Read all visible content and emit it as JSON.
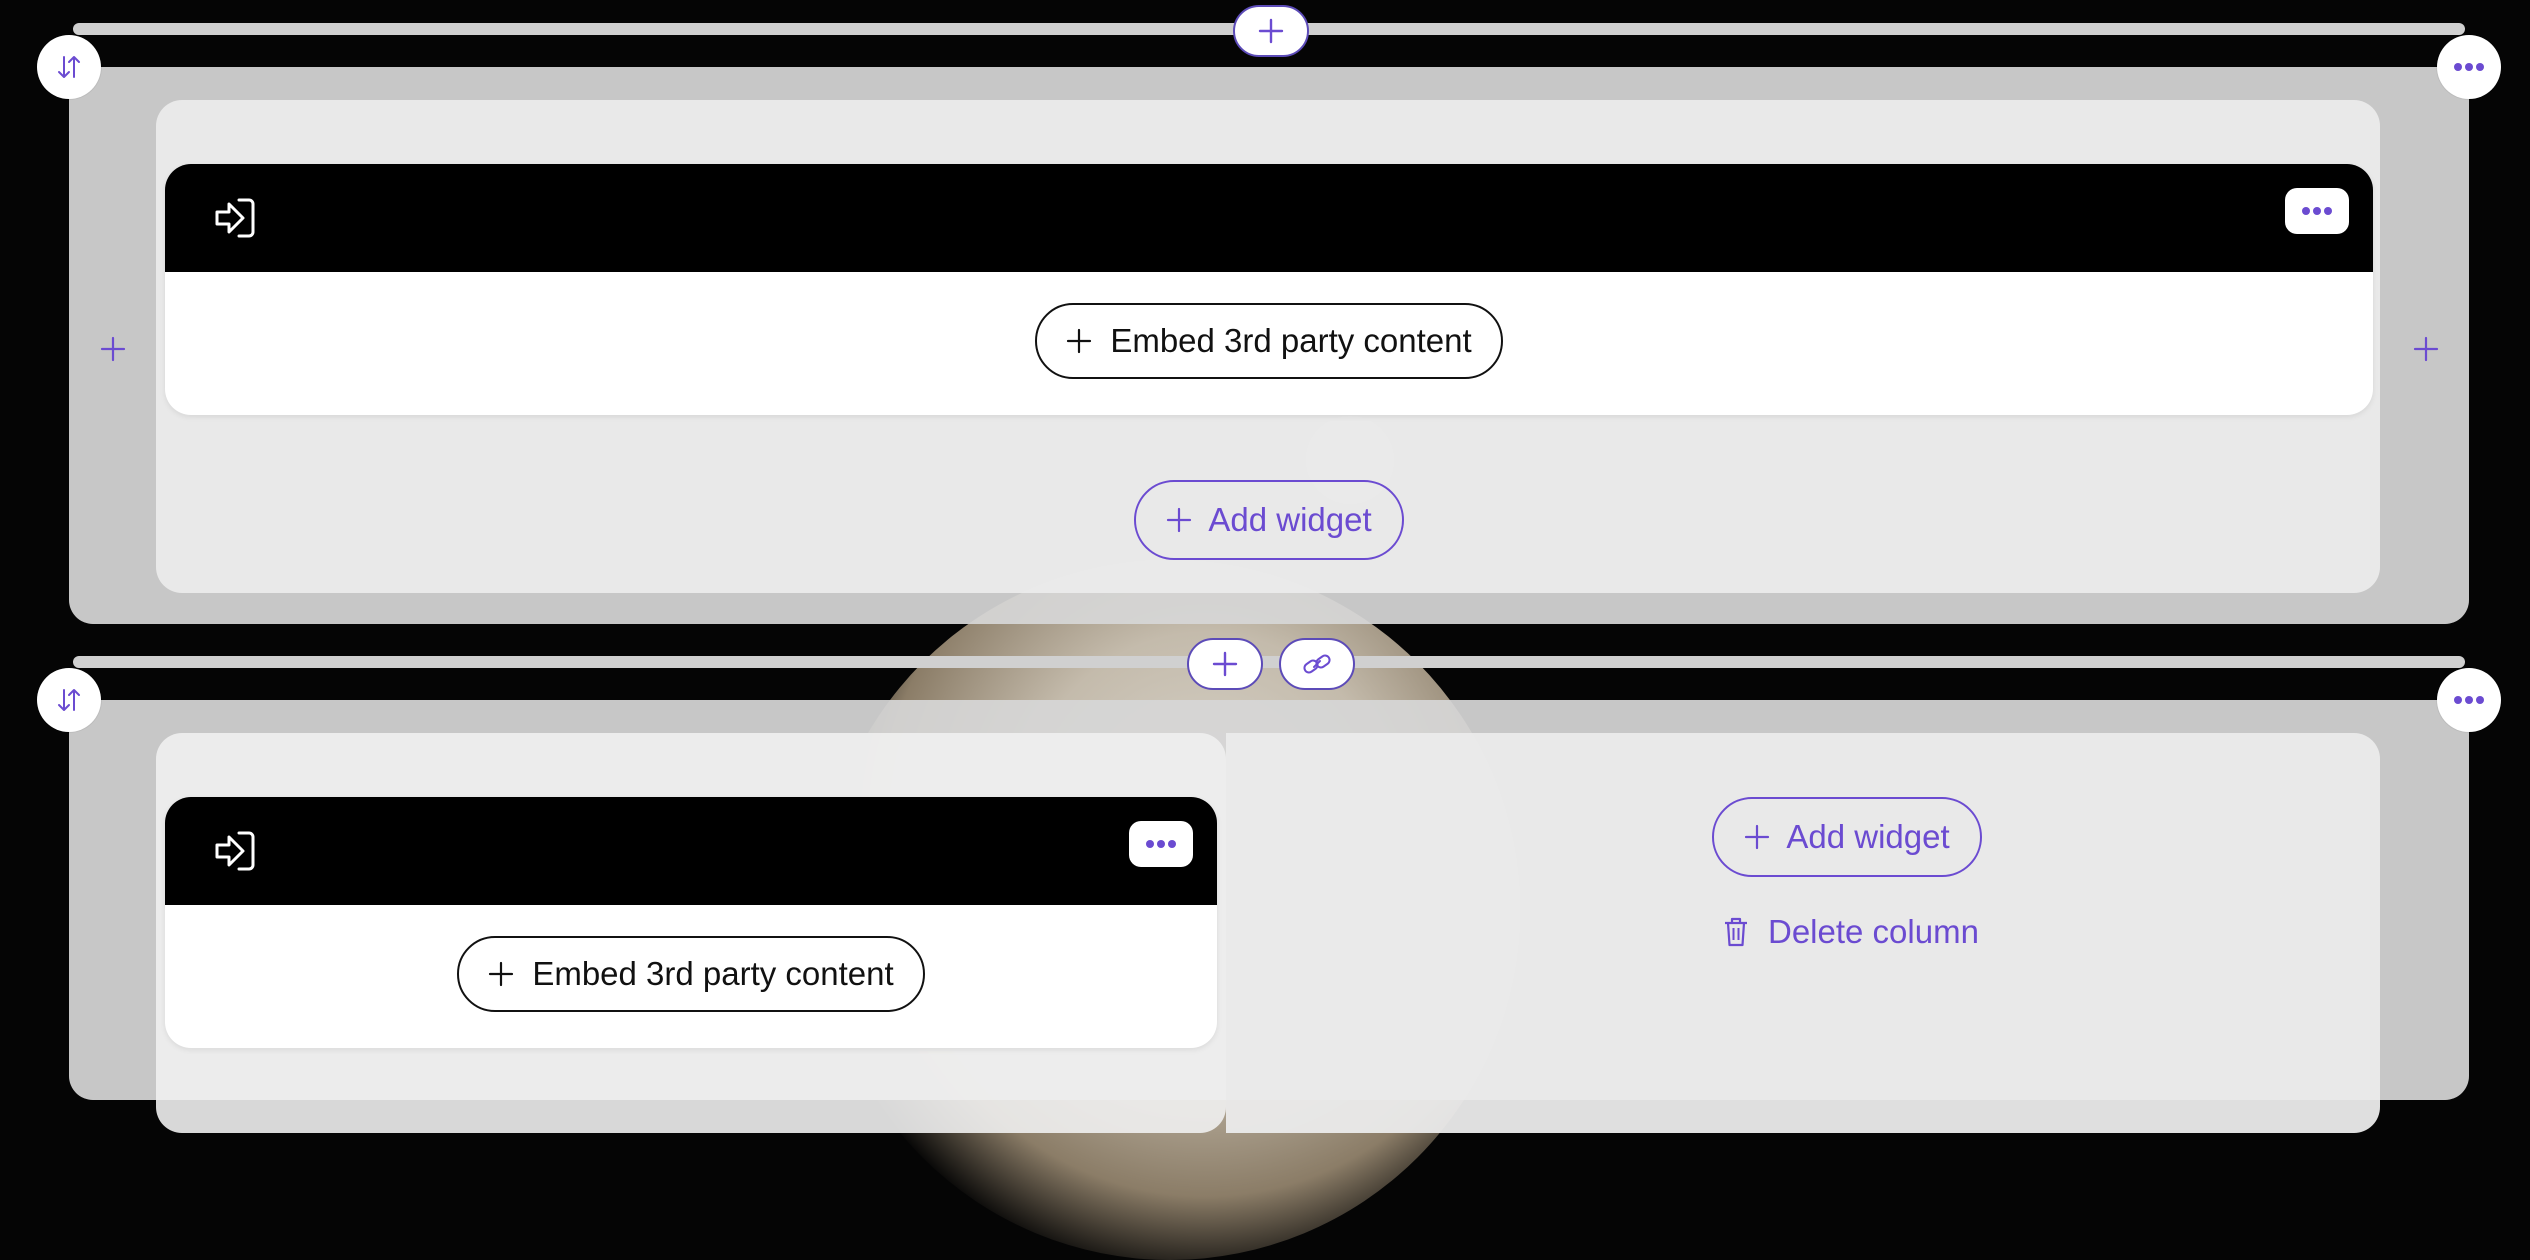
{
  "sections": [
    {
      "columns": [
        {
          "widgets": [
            {
              "icon": "login-arrow-icon",
              "action_label": "Embed 3rd party content"
            }
          ],
          "add_widget_label": "Add widget"
        }
      ]
    },
    {
      "columns": [
        {
          "widgets": [
            {
              "icon": "login-arrow-icon",
              "action_label": "Embed 3rd party content"
            }
          ]
        },
        {
          "add_widget_label": "Add widget",
          "delete_column_label": "Delete column"
        }
      ]
    }
  ],
  "colors": {
    "accent": "#6b4bd1",
    "section_bg": "#d6d6d6",
    "column_bg": "#ebebeb",
    "widget_header": "#000000",
    "page_bg": "#050505"
  },
  "icons": [
    "plus-icon",
    "sort-arrows-icon",
    "more-dots-icon",
    "link-icon",
    "login-arrow-icon",
    "trash-icon"
  ]
}
